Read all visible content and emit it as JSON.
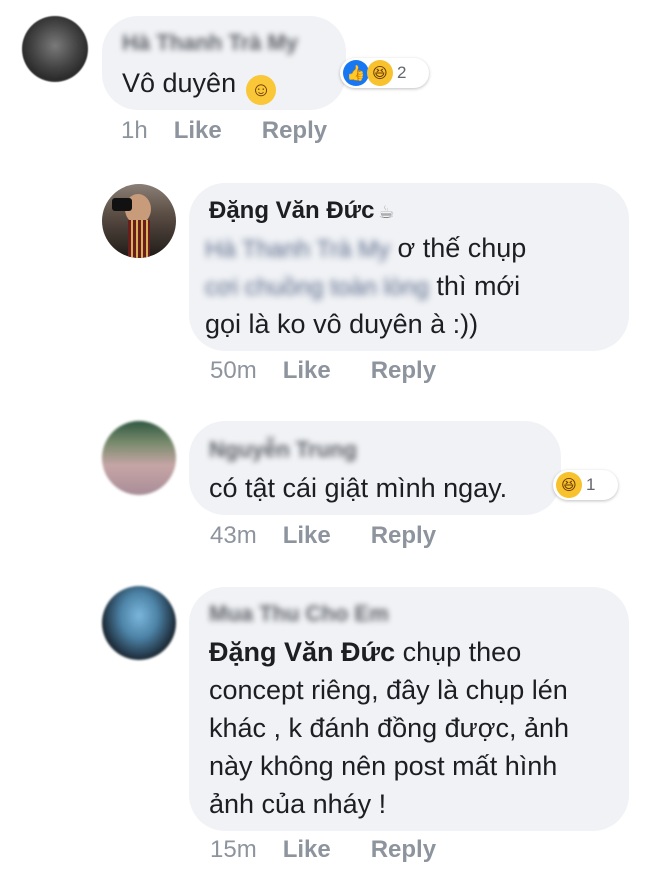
{
  "comments": [
    {
      "author": "Hà Thanh Trà My",
      "text": "Vô duyên",
      "emoji": "☺",
      "reactions": {
        "icons": [
          "like-icon",
          "haha-icon"
        ],
        "count": "2"
      },
      "time": "1h",
      "like_label": "Like",
      "reply_label": "Reply"
    },
    {
      "author": "Đặng Văn Đức",
      "author_badge": "☕",
      "mention": "Hà Thanh Trà My",
      "line1_rest": "ơ thế chụp",
      "line2_blur": "cơi chuồng toàn lòng",
      "line2_rest": "thì mới",
      "line3": "gọi là ko vô duyên à :))",
      "time": "50m",
      "like_label": "Like",
      "reply_label": "Reply"
    },
    {
      "author": "Nguyễn Trung",
      "text": "có tật cái giật mình ngay.",
      "reactions": {
        "icons": [
          "haha-icon"
        ],
        "count": "1"
      },
      "time": "43m",
      "like_label": "Like",
      "reply_label": "Reply"
    },
    {
      "author": "Mua Thu Cho Em",
      "mention": "Đặng Văn Đức",
      "line1_rest": "chụp theo",
      "line2": "concept riêng, đây là chụp lén",
      "line3": "khác , k đánh đồng được, ảnh",
      "line4": "này không nên post mất hình",
      "line5": "ảnh của nháy !",
      "time": "15m",
      "like_label": "Like",
      "reply_label": "Reply"
    }
  ],
  "colors": {
    "bubble": "#f0f2f5",
    "meta_text": "#8d949e",
    "like_blue": "#1877f2",
    "haha_yellow": "#f7c22e"
  }
}
